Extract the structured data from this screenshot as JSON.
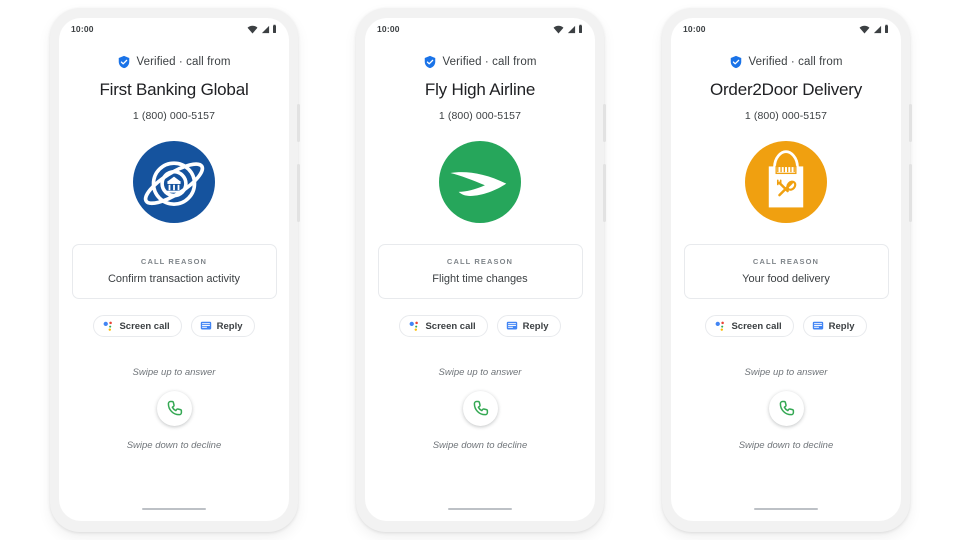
{
  "scene": {
    "background_color": "#ffffff",
    "description": "Three Android phone mockups showing Verified Calls incoming-call screens"
  },
  "status_bar": {
    "time": "10:00",
    "icons": [
      "wifi-icon",
      "signal-icon",
      "battery-icon"
    ]
  },
  "shared": {
    "verified_label": "Verified · call from",
    "phone_number": "1 (800) 000-5157",
    "reason_label": "CALL REASON",
    "screen_call_label": "Screen call",
    "reply_label": "Reply",
    "swipe_up_label": "Swipe up to answer",
    "swipe_down_label": "Swipe down to decline",
    "verified_badge_color": "#1a73e8",
    "answer_icon_color": "#34a853"
  },
  "phones": [
    {
      "caller_name": "First Banking Global",
      "reason_text": "Confirm transaction activity",
      "logo": {
        "name": "bank-planet-logo",
        "background_color": "#15539e",
        "glyph_color": "#ffffff"
      }
    },
    {
      "caller_name": "Fly High Airline",
      "reason_text": "Flight time changes",
      "logo": {
        "name": "airline-swoosh-logo",
        "background_color": "#26a65b",
        "glyph_color": "#ffffff"
      }
    },
    {
      "caller_name": "Order2Door Delivery",
      "reason_text": "Your food delivery",
      "logo": {
        "name": "food-bag-logo",
        "background_color": "#f0a010",
        "glyph_color": "#ffffff"
      }
    }
  ]
}
